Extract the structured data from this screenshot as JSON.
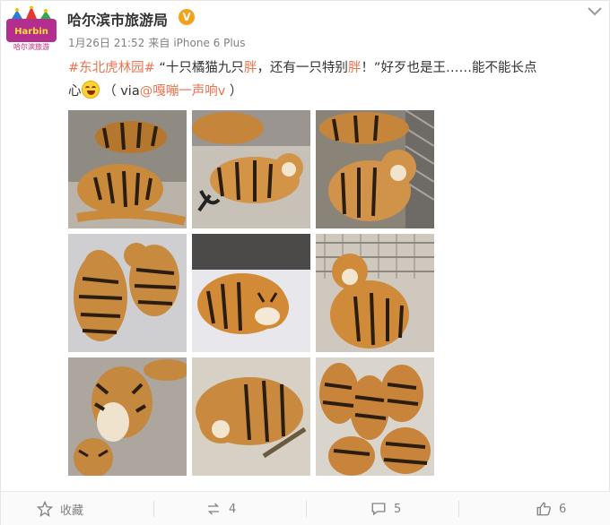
{
  "account": {
    "name": "哈尔滨市旅游局",
    "verified_icon": "verified-v-icon",
    "logo_text": "哈尔滨旅游"
  },
  "meta": {
    "date": "1月26日 21:52",
    "source_prefix": "来自",
    "source": "iPhone 6 Plus"
  },
  "post": {
    "hashtag": "#东北虎林园#",
    "quote_open": "“十只橘猫九只",
    "fat1": "胖",
    "mid": "，还有一只特别",
    "fat2": "胖",
    "quote_close": "！”",
    "line_rest": "好歹也是王……能不能长点",
    "line2_start": "心",
    "via_open": "（ via",
    "via_user": "@嘎嘣一声响v",
    "via_close": " ）"
  },
  "images": [
    {
      "label": "tiger-photo-1"
    },
    {
      "label": "tiger-photo-2"
    },
    {
      "label": "tiger-photo-3"
    },
    {
      "label": "tiger-photo-4"
    },
    {
      "label": "tiger-photo-5"
    },
    {
      "label": "tiger-photo-6"
    },
    {
      "label": "tiger-photo-7"
    },
    {
      "label": "tiger-photo-8"
    },
    {
      "label": "tiger-photo-9"
    }
  ],
  "actions": {
    "favorite_label": "收藏",
    "repost_count": "4",
    "comment_count": "5",
    "like_count": "6"
  },
  "colors": {
    "accent": "#eb7350",
    "muted": "#808080",
    "verified": "#f6a01a"
  }
}
